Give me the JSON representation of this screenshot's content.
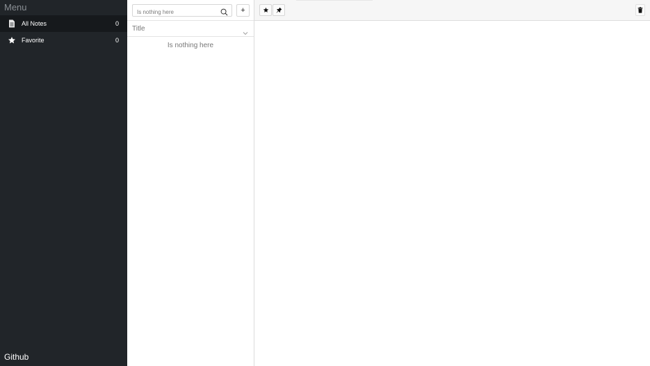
{
  "sidebar": {
    "title": "Menu",
    "items": [
      {
        "label": "All Notes",
        "count": "0",
        "icon": "document-icon",
        "active": true
      },
      {
        "label": "Favorite",
        "count": "0",
        "icon": "star-icon",
        "active": false
      }
    ],
    "footer": "Github"
  },
  "list": {
    "search_placeholder": "Is nothing here",
    "add_label": "+",
    "sort_label": "Title",
    "empty_message": "Is nothing here"
  },
  "editor": {
    "toolbar_icons": [
      "star-icon",
      "pin-icon",
      "trash-icon"
    ]
  },
  "colors": {
    "sidebar_bg": "#212529",
    "sidebar_active_bg": "#16191c",
    "toolbar_bg": "#f6f6f6"
  }
}
